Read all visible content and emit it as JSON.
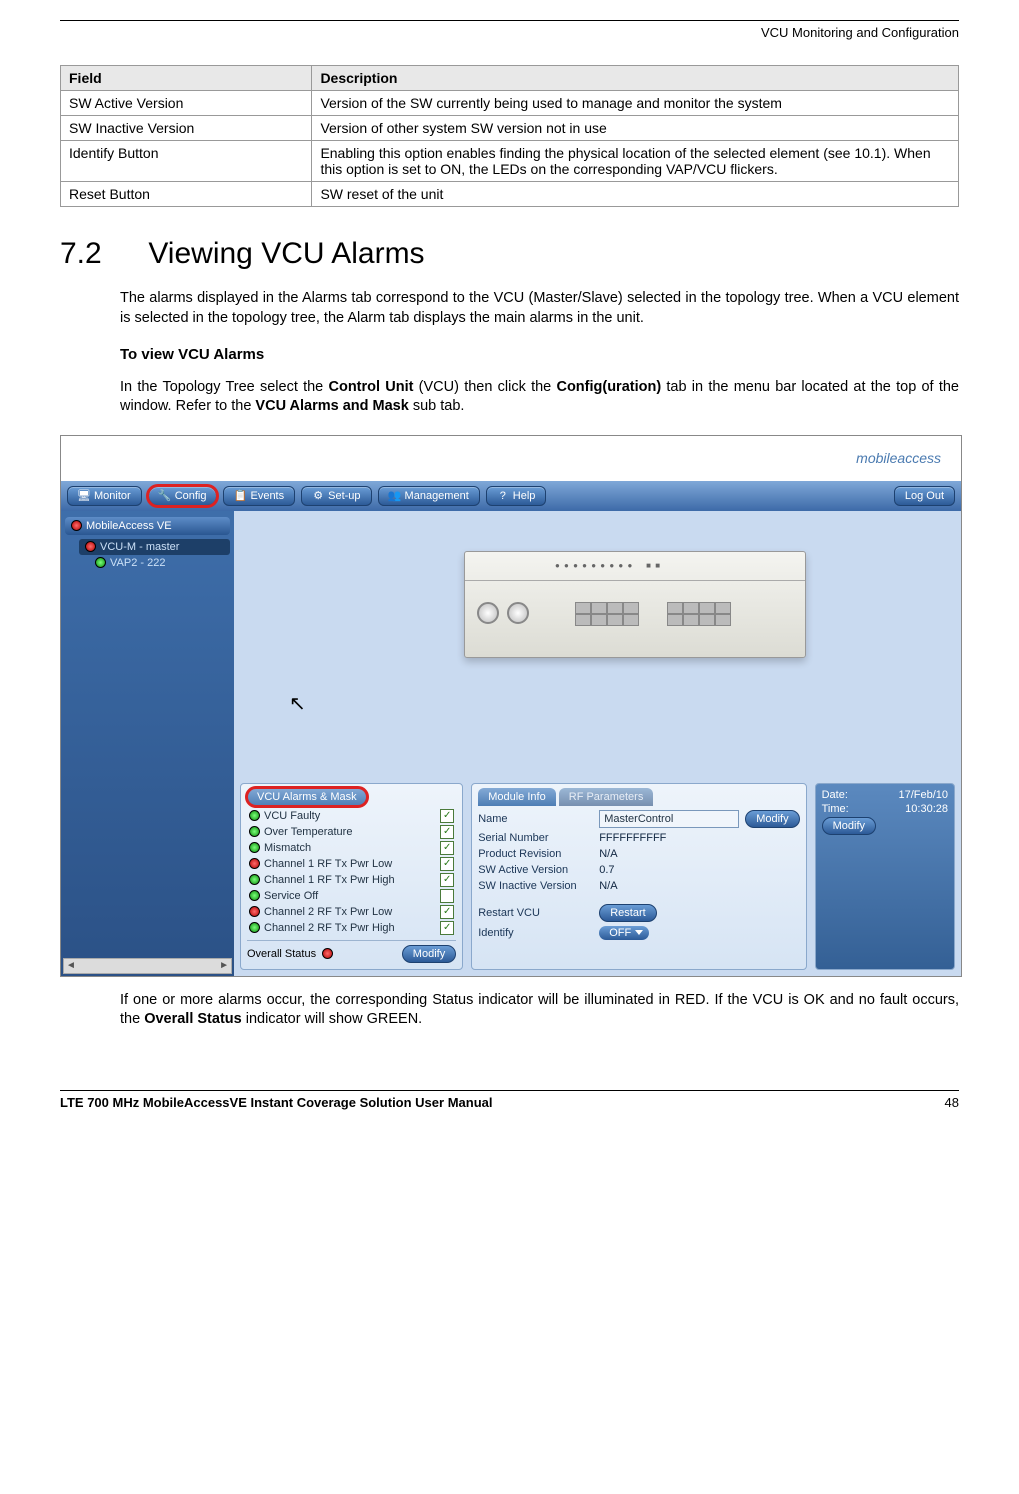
{
  "header": {
    "right": "VCU Monitoring and Configuration"
  },
  "table": {
    "head_field": "Field",
    "head_desc": "Description",
    "rows": [
      {
        "field": "SW Active Version",
        "desc": "Version of the SW currently being used to manage and monitor the system"
      },
      {
        "field": "SW Inactive Version",
        "desc": "Version  of other system SW version not in use"
      },
      {
        "field": "Identify Button",
        "desc": "Enabling this option enables finding the physical location of the selected element (see 10.1). When this option is set to ON, the LEDs on the corresponding VAP/VCU flickers."
      },
      {
        "field": "Reset Button",
        "desc": "SW reset of the unit"
      }
    ]
  },
  "section": {
    "num": "7.2",
    "title": "Viewing VCU Alarms",
    "para1": "The alarms displayed in the Alarms tab correspond to the VCU (Master/Slave) selected in the topology tree. When a VCU element is selected in the topology tree, the Alarm tab displays the main alarms in the unit.",
    "subhead": "To view VCU Alarms",
    "para2_a": "In the Topology Tree select the ",
    "para2_b": "Control Unit",
    "para2_c": " (VCU) then click the ",
    "para2_d": "Config(uration)",
    "para2_e": " tab in the menu bar located at the top of the window.  Refer to the ",
    "para2_f": "VCU Alarms and Mask",
    "para2_g": " sub tab.",
    "after_a": "If one or more alarms occur, the corresponding Status indicator will be illuminated in RED. If the VCU is OK and no fault occurs, the ",
    "after_b": "Overall Status",
    "after_c": " indicator will show GREEN."
  },
  "app": {
    "logo": "mobileaccess",
    "menu": {
      "monitor": "Monitor",
      "config": "Config",
      "events": "Events",
      "setup": "Set-up",
      "management": "Management",
      "help": "Help",
      "logout": "Log Out"
    },
    "tree": {
      "root": "MobileAccess VE",
      "node1": "VCU-M - master",
      "node2": "VAP2 - 222"
    },
    "alarms_tab": "VCU Alarms & Mask",
    "alarms": [
      {
        "label": "VCU Faulty",
        "color": "green",
        "checked": true
      },
      {
        "label": "Over Temperature",
        "color": "green",
        "checked": true
      },
      {
        "label": "Mismatch",
        "color": "green",
        "checked": true
      },
      {
        "label": "Channel 1 RF Tx Pwr Low",
        "color": "red",
        "checked": true
      },
      {
        "label": "Channel 1 RF Tx Pwr High",
        "color": "green",
        "checked": true
      },
      {
        "label": "Service Off",
        "color": "green",
        "checked": false
      },
      {
        "label": "Channel 2 RF Tx Pwr Low",
        "color": "red",
        "checked": true
      },
      {
        "label": "Channel 2 RF Tx Pwr High",
        "color": "green",
        "checked": true
      }
    ],
    "overall_label": "Overall Status",
    "modify_btn": "Modify",
    "module_tab": "Module Info",
    "rf_tab": "RF Parameters",
    "module": {
      "name_label": "Name",
      "name_value": "MasterControl",
      "serial_label": "Serial Number",
      "serial_value": "FFFFFFFFFF",
      "rev_label": "Product Revision",
      "rev_value": "N/A",
      "swact_label": "SW Active Version",
      "swact_value": "0.7",
      "swinact_label": "SW Inactive Version",
      "swinact_value": "N/A",
      "restart_label": "Restart VCU",
      "restart_btn": "Restart",
      "identify_label": "Identify",
      "identify_value": "OFF"
    },
    "datetime": {
      "date_label": "Date:",
      "date_value": "17/Feb/10",
      "time_label": "Time:",
      "time_value": "10:30:28"
    }
  },
  "footer": {
    "title": "LTE 700 MHz MobileAccessVE Instant Coverage Solution User Manual",
    "page": "48"
  }
}
